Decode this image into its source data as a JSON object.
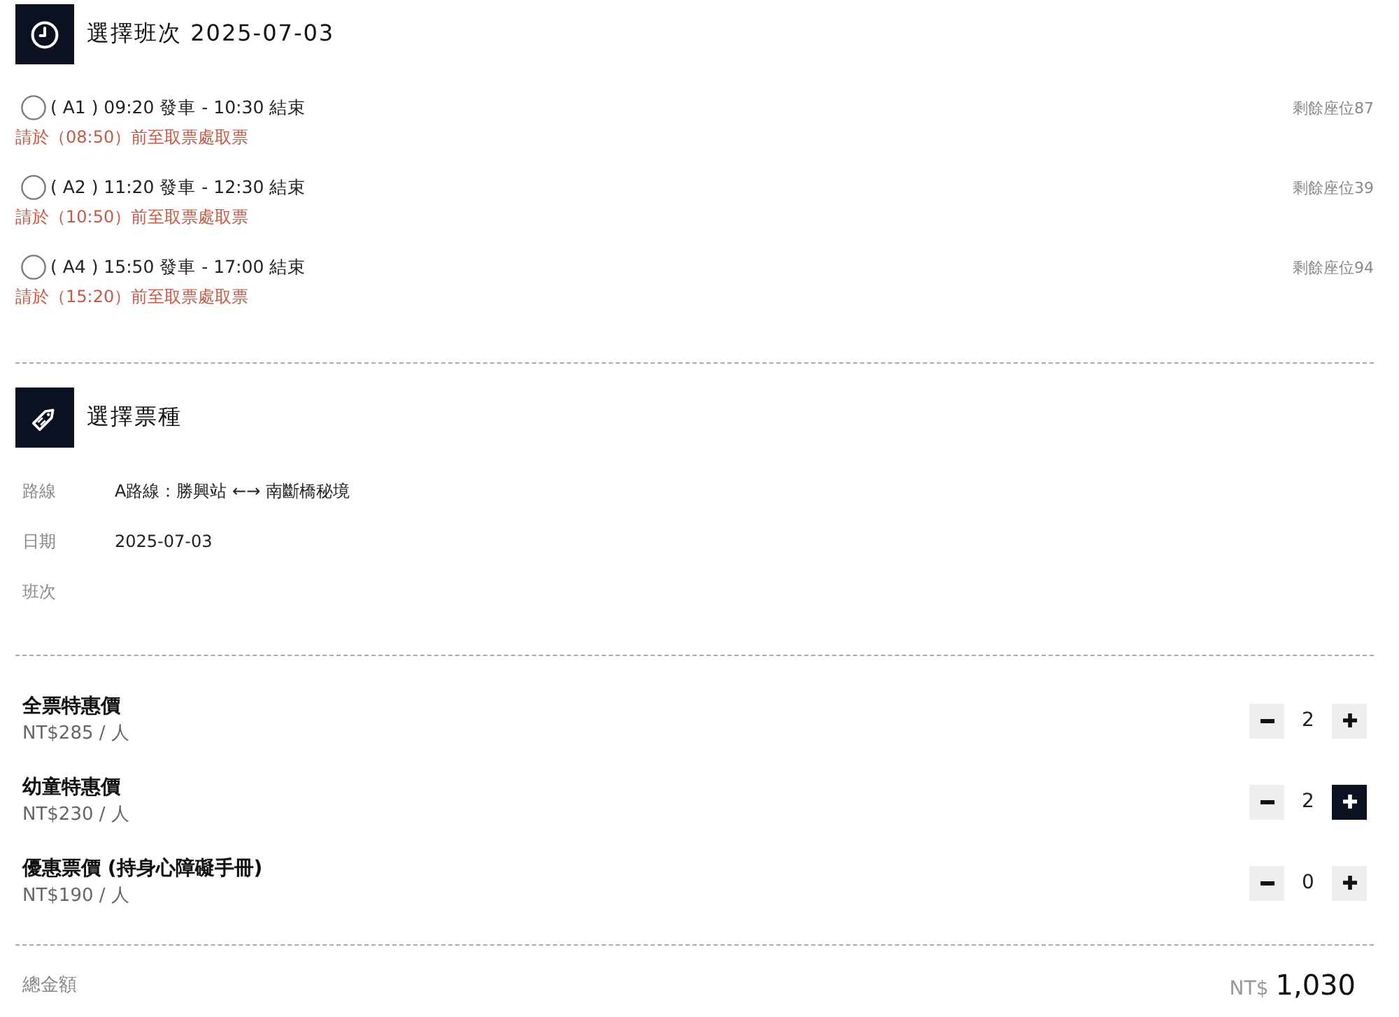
{
  "schedule": {
    "title": "選擇班次 2025-07-03",
    "trips": [
      {
        "label": "( A1 ) 09:20 發車 - 10:30 結束",
        "pickup_note": "請於（08:50）前至取票處取票",
        "seats": "剩餘座位87",
        "selected": false
      },
      {
        "label": "( A2 ) 11:20 發車 - 12:30 結束",
        "pickup_note": "請於（10:50）前至取票處取票",
        "seats": "剩餘座位39",
        "selected": false
      },
      {
        "label": "( A4 ) 15:50 發車 - 17:00 結束",
        "pickup_note": "請於（15:20）前至取票處取票",
        "seats": "剩餘座位94",
        "selected": false
      }
    ]
  },
  "ticket_section": {
    "title": "選擇票種",
    "details": [
      {
        "label": "路線",
        "value": "A路線：勝興站 ←→ 南斷橋秘境"
      },
      {
        "label": "日期",
        "value": "2025-07-03"
      },
      {
        "label": "班次"
      }
    ],
    "tickets": [
      {
        "name": "全票特惠價",
        "price": "NT$285 / 人",
        "quantity": "2",
        "plus_highlighted": false
      },
      {
        "name": "幼童特惠價",
        "price": "NT$230 / 人",
        "quantity": "2",
        "plus_highlighted": true
      },
      {
        "name": "優惠票價 (持身心障礙手冊)",
        "price": "NT$190 / 人",
        "quantity": "0",
        "plus_highlighted": false
      }
    ]
  },
  "total": {
    "label": "總金額",
    "currency": "NT$",
    "amount": "1,030"
  }
}
